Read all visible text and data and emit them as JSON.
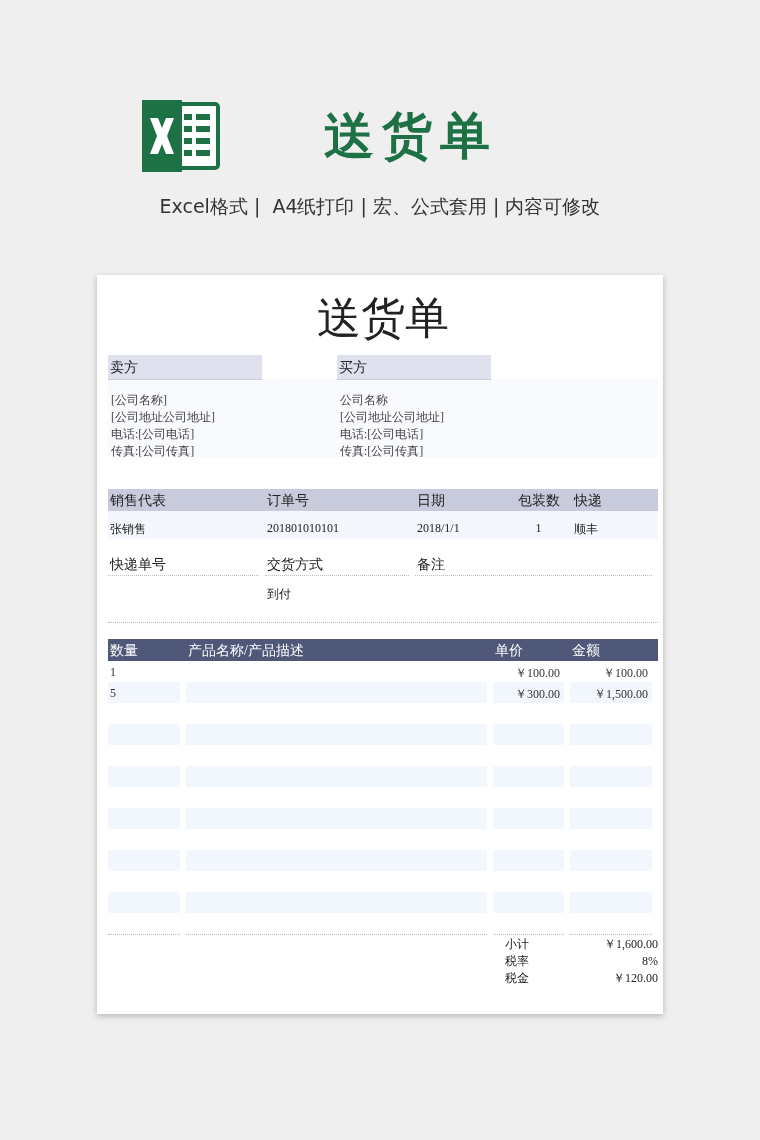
{
  "banner": {
    "title": "送货单",
    "subtitle": "Excel格式 |  A4纸打印 | 宏、公式套用 | 内容可修改"
  },
  "sheet": {
    "title": "送货单",
    "seller": {
      "label": "卖方",
      "lines": [
        "[公司名称]",
        "[公司地址公司地址]",
        "电话:[公司电话]",
        "传真:[公司传真]"
      ]
    },
    "buyer": {
      "label": "买方",
      "lines": [
        "公司名称",
        "[公司地址公司地址]",
        "电话:[公司电话]",
        "传真:[公司传真]"
      ]
    },
    "order": {
      "columns": [
        "销售代表",
        "订单号",
        "日期",
        "包装数",
        "快递"
      ],
      "values": [
        "张销售",
        "201801010101",
        "2018/1/1",
        "1",
        "顺丰"
      ]
    },
    "shipping": {
      "columns": [
        "快递单号",
        "交货方式",
        "备注"
      ],
      "delivery_method": "到付"
    },
    "items": {
      "columns": [
        "数量",
        "产品名称/产品描述",
        "单价",
        "金额"
      ],
      "rows": [
        {
          "qty": "1",
          "unit_price": "￥100.00",
          "amount": "￥100.00"
        },
        {
          "qty": "5",
          "unit_price": "￥300.00",
          "amount": "￥1,500.00"
        }
      ]
    },
    "totals": [
      {
        "label": "小计",
        "value": "￥1,600.00"
      },
      {
        "label": "税率",
        "value": "8%"
      },
      {
        "label": "税金",
        "value": "￥120.00"
      }
    ]
  }
}
